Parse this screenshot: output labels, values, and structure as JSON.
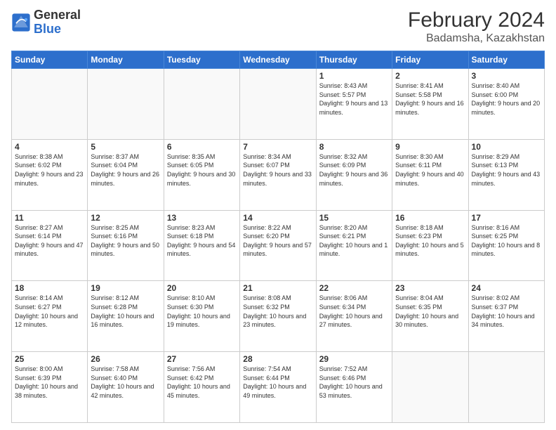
{
  "logo": {
    "general": "General",
    "blue": "Blue"
  },
  "header": {
    "month_year": "February 2024",
    "location": "Badamsha, Kazakhstan"
  },
  "weekdays": [
    "Sunday",
    "Monday",
    "Tuesday",
    "Wednesday",
    "Thursday",
    "Friday",
    "Saturday"
  ],
  "weeks": [
    [
      {
        "day": "",
        "sunrise": "",
        "sunset": "",
        "daylight": ""
      },
      {
        "day": "",
        "sunrise": "",
        "sunset": "",
        "daylight": ""
      },
      {
        "day": "",
        "sunrise": "",
        "sunset": "",
        "daylight": ""
      },
      {
        "day": "",
        "sunrise": "",
        "sunset": "",
        "daylight": ""
      },
      {
        "day": "1",
        "sunrise": "Sunrise: 8:43 AM",
        "sunset": "Sunset: 5:57 PM",
        "daylight": "Daylight: 9 hours and 13 minutes."
      },
      {
        "day": "2",
        "sunrise": "Sunrise: 8:41 AM",
        "sunset": "Sunset: 5:58 PM",
        "daylight": "Daylight: 9 hours and 16 minutes."
      },
      {
        "day": "3",
        "sunrise": "Sunrise: 8:40 AM",
        "sunset": "Sunset: 6:00 PM",
        "daylight": "Daylight: 9 hours and 20 minutes."
      }
    ],
    [
      {
        "day": "4",
        "sunrise": "Sunrise: 8:38 AM",
        "sunset": "Sunset: 6:02 PM",
        "daylight": "Daylight: 9 hours and 23 minutes."
      },
      {
        "day": "5",
        "sunrise": "Sunrise: 8:37 AM",
        "sunset": "Sunset: 6:04 PM",
        "daylight": "Daylight: 9 hours and 26 minutes."
      },
      {
        "day": "6",
        "sunrise": "Sunrise: 8:35 AM",
        "sunset": "Sunset: 6:05 PM",
        "daylight": "Daylight: 9 hours and 30 minutes."
      },
      {
        "day": "7",
        "sunrise": "Sunrise: 8:34 AM",
        "sunset": "Sunset: 6:07 PM",
        "daylight": "Daylight: 9 hours and 33 minutes."
      },
      {
        "day": "8",
        "sunrise": "Sunrise: 8:32 AM",
        "sunset": "Sunset: 6:09 PM",
        "daylight": "Daylight: 9 hours and 36 minutes."
      },
      {
        "day": "9",
        "sunrise": "Sunrise: 8:30 AM",
        "sunset": "Sunset: 6:11 PM",
        "daylight": "Daylight: 9 hours and 40 minutes."
      },
      {
        "day": "10",
        "sunrise": "Sunrise: 8:29 AM",
        "sunset": "Sunset: 6:13 PM",
        "daylight": "Daylight: 9 hours and 43 minutes."
      }
    ],
    [
      {
        "day": "11",
        "sunrise": "Sunrise: 8:27 AM",
        "sunset": "Sunset: 6:14 PM",
        "daylight": "Daylight: 9 hours and 47 minutes."
      },
      {
        "day": "12",
        "sunrise": "Sunrise: 8:25 AM",
        "sunset": "Sunset: 6:16 PM",
        "daylight": "Daylight: 9 hours and 50 minutes."
      },
      {
        "day": "13",
        "sunrise": "Sunrise: 8:23 AM",
        "sunset": "Sunset: 6:18 PM",
        "daylight": "Daylight: 9 hours and 54 minutes."
      },
      {
        "day": "14",
        "sunrise": "Sunrise: 8:22 AM",
        "sunset": "Sunset: 6:20 PM",
        "daylight": "Daylight: 9 hours and 57 minutes."
      },
      {
        "day": "15",
        "sunrise": "Sunrise: 8:20 AM",
        "sunset": "Sunset: 6:21 PM",
        "daylight": "Daylight: 10 hours and 1 minute."
      },
      {
        "day": "16",
        "sunrise": "Sunrise: 8:18 AM",
        "sunset": "Sunset: 6:23 PM",
        "daylight": "Daylight: 10 hours and 5 minutes."
      },
      {
        "day": "17",
        "sunrise": "Sunrise: 8:16 AM",
        "sunset": "Sunset: 6:25 PM",
        "daylight": "Daylight: 10 hours and 8 minutes."
      }
    ],
    [
      {
        "day": "18",
        "sunrise": "Sunrise: 8:14 AM",
        "sunset": "Sunset: 6:27 PM",
        "daylight": "Daylight: 10 hours and 12 minutes."
      },
      {
        "day": "19",
        "sunrise": "Sunrise: 8:12 AM",
        "sunset": "Sunset: 6:28 PM",
        "daylight": "Daylight: 10 hours and 16 minutes."
      },
      {
        "day": "20",
        "sunrise": "Sunrise: 8:10 AM",
        "sunset": "Sunset: 6:30 PM",
        "daylight": "Daylight: 10 hours and 19 minutes."
      },
      {
        "day": "21",
        "sunrise": "Sunrise: 8:08 AM",
        "sunset": "Sunset: 6:32 PM",
        "daylight": "Daylight: 10 hours and 23 minutes."
      },
      {
        "day": "22",
        "sunrise": "Sunrise: 8:06 AM",
        "sunset": "Sunset: 6:34 PM",
        "daylight": "Daylight: 10 hours and 27 minutes."
      },
      {
        "day": "23",
        "sunrise": "Sunrise: 8:04 AM",
        "sunset": "Sunset: 6:35 PM",
        "daylight": "Daylight: 10 hours and 30 minutes."
      },
      {
        "day": "24",
        "sunrise": "Sunrise: 8:02 AM",
        "sunset": "Sunset: 6:37 PM",
        "daylight": "Daylight: 10 hours and 34 minutes."
      }
    ],
    [
      {
        "day": "25",
        "sunrise": "Sunrise: 8:00 AM",
        "sunset": "Sunset: 6:39 PM",
        "daylight": "Daylight: 10 hours and 38 minutes."
      },
      {
        "day": "26",
        "sunrise": "Sunrise: 7:58 AM",
        "sunset": "Sunset: 6:40 PM",
        "daylight": "Daylight: 10 hours and 42 minutes."
      },
      {
        "day": "27",
        "sunrise": "Sunrise: 7:56 AM",
        "sunset": "Sunset: 6:42 PM",
        "daylight": "Daylight: 10 hours and 45 minutes."
      },
      {
        "day": "28",
        "sunrise": "Sunrise: 7:54 AM",
        "sunset": "Sunset: 6:44 PM",
        "daylight": "Daylight: 10 hours and 49 minutes."
      },
      {
        "day": "29",
        "sunrise": "Sunrise: 7:52 AM",
        "sunset": "Sunset: 6:46 PM",
        "daylight": "Daylight: 10 hours and 53 minutes."
      },
      {
        "day": "",
        "sunrise": "",
        "sunset": "",
        "daylight": ""
      },
      {
        "day": "",
        "sunrise": "",
        "sunset": "",
        "daylight": ""
      }
    ]
  ]
}
